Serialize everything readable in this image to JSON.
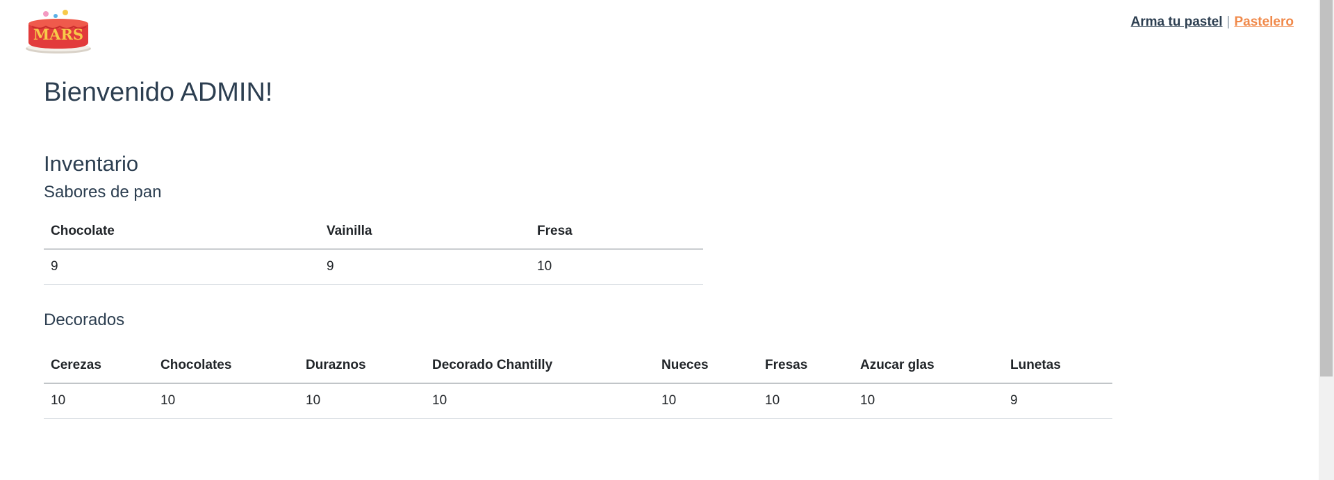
{
  "header": {
    "logo_text": "MARS",
    "nav": [
      {
        "label": "Arma tu pastel",
        "active": false
      },
      {
        "label": "Pastelero",
        "active": true
      }
    ],
    "separator": "|"
  },
  "main": {
    "welcome": "Bienvenido ADMIN!",
    "inventory_title": "Inventario",
    "flavors": {
      "title": "Sabores de pan",
      "headers": [
        "Chocolate",
        "Vainilla",
        "Fresa"
      ],
      "values": [
        "9",
        "9",
        "10"
      ]
    },
    "decorations": {
      "title": "Decorados",
      "headers": [
        "Cerezas",
        "Chocolates",
        "Duraznos",
        "Decorado Chantilly",
        "Nueces",
        "Fresas",
        "Azucar glas",
        "Lunetas"
      ],
      "values": [
        "10",
        "10",
        "10",
        "10",
        "10",
        "10",
        "10",
        "9"
      ]
    }
  },
  "colors": {
    "text": "#2c3e50",
    "active_link": "#f0894a",
    "logo_red": "#e23b3b",
    "logo_text": "#f7c94a"
  }
}
